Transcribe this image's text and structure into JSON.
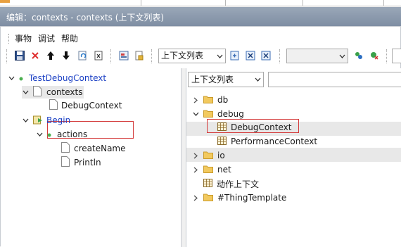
{
  "title": "编辑：contexts - contexts (上下文列表)",
  "menu": [
    "事物",
    "调试",
    "帮助"
  ],
  "toolbar": {
    "combo_value": "上下文列表",
    "combo2_value": ""
  },
  "left_tree": {
    "root": "TestDebugContext",
    "contexts": "contexts",
    "debug_context": "DebugContext",
    "begin": "Begin",
    "actions": "actions",
    "create_name": "createName",
    "println": "Println"
  },
  "right_panel": {
    "filter_value": "上下文列表",
    "filter_input": "",
    "items": {
      "db": "db",
      "debug": "debug",
      "debug_context": "DebugContext",
      "performance_context": "PerformanceContext",
      "io": "io",
      "net": "net",
      "action_context": "动作上下文",
      "thing_template": "#ThingTemplate"
    }
  },
  "colors": {
    "titlebar": "#8a98ab",
    "highlight_border": "#d43a3a",
    "link_blue": "#1a3fc4"
  }
}
